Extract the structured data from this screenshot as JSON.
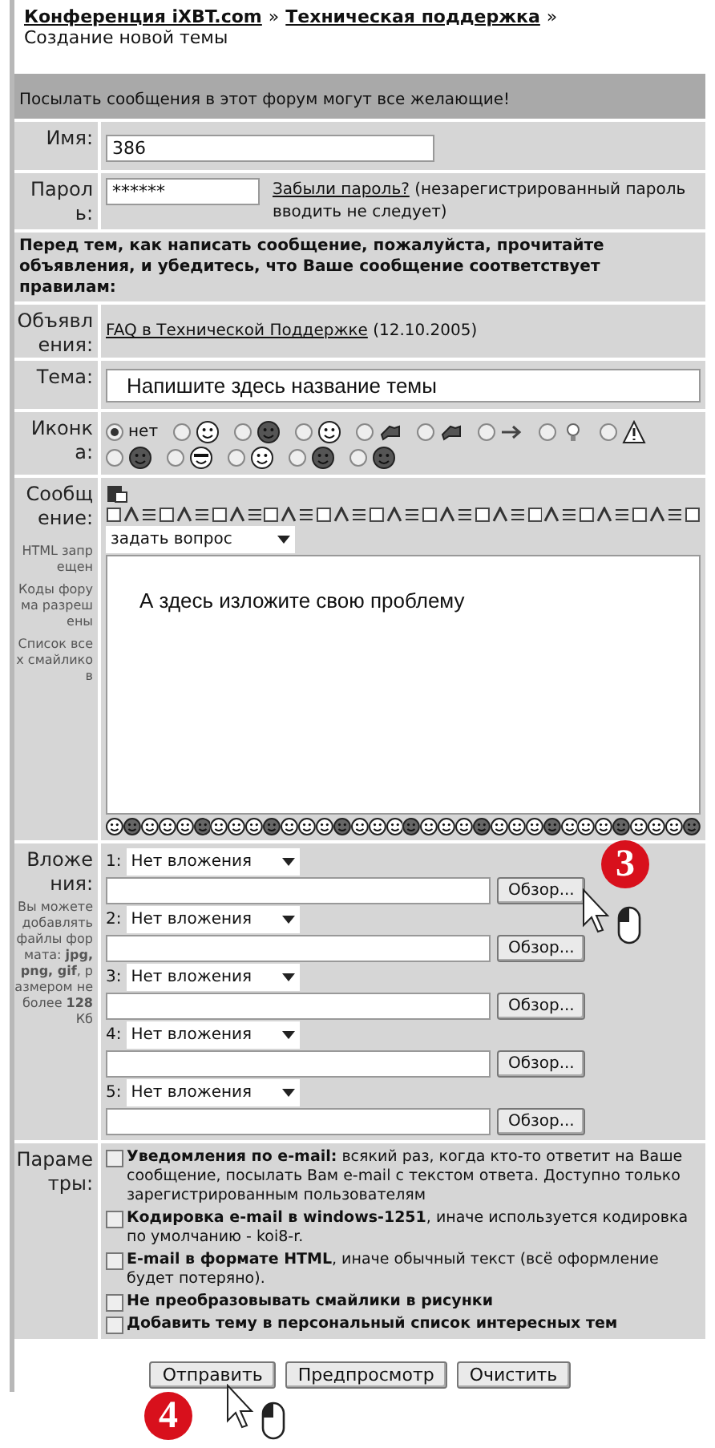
{
  "breadcrumb": {
    "links": [
      "Конференция iXBT.com",
      "Техническая поддержка"
    ],
    "separator": "»",
    "current": "Создание новой темы"
  },
  "notice_bar": "Посылать сообщения в этот форум могут все желающие!",
  "name_field": {
    "label": "Имя:",
    "value": "386"
  },
  "password_field": {
    "label": "Пароль:",
    "value": "******",
    "forgot_link": "Забыли пароль?",
    "hint": "(незарегистрированный пароль вводить не следует)"
  },
  "rules_notice": "Перед тем, как написать сообщение, пожалуйста, прочитайте объявления, и убедитесь, что Ваше сообщение соответствует правилам:",
  "announcements": {
    "label": "Объявления:",
    "link": "FAQ в Технической Поддержке",
    "date": "(12.10.2005)"
  },
  "subject": {
    "label": "Тема:",
    "value": "Напишите здесь название темы"
  },
  "icon_field": {
    "label": "Иконка:",
    "options": [
      {
        "label": "нет",
        "selected": true
      },
      {
        "selected": false
      },
      {
        "selected": false
      },
      {
        "selected": false
      },
      {
        "selected": false
      },
      {
        "selected": false
      },
      {
        "selected": false
      },
      {
        "selected": false
      },
      {
        "selected": false
      },
      {
        "selected": false
      },
      {
        "selected": false
      },
      {
        "selected": false
      },
      {
        "selected": false
      },
      {
        "selected": false
      }
    ]
  },
  "message": {
    "label": "Сообщение:",
    "notes": [
      "HTML запрещен",
      "Коды форума разрешены",
      "Список всех смайликов"
    ],
    "select_value": "задать вопрос",
    "value": "А здесь изложите свою проблему"
  },
  "attachments": {
    "label": "Вложения:",
    "hint": "Вы можете добавлять файлы формата: **jpg, png, gif**, размером не более **128** Кб",
    "items": [
      {
        "number": "1:",
        "select_value": "Нет вложения",
        "browse": "Обзор..."
      },
      {
        "number": "2:",
        "select_value": "Нет вложения",
        "browse": "Обзор..."
      },
      {
        "number": "3:",
        "select_value": "Нет вложения",
        "browse": "Обзор..."
      },
      {
        "number": "4:",
        "select_value": "Нет вложения",
        "browse": "Обзор..."
      },
      {
        "number": "5:",
        "select_value": "Нет вложения",
        "browse": "Обзор..."
      }
    ]
  },
  "options": {
    "label": "Параметры:",
    "items": [
      {
        "text": "**Уведомления по e-mail:** всякий раз, когда кто-то ответит на Ваше сообщение, посылать Вам e-mail с текстом ответа. Доступно только зарегистрированным пользователям",
        "checked": false
      },
      {
        "text": "**Кодировка e-mail в windows-1251**, иначе используется кодировка по умолчанию - koi8-r.",
        "checked": false
      },
      {
        "text": "**E-mail в формате HTML**, иначе обычный текст (всё оформление будет потеряно).",
        "checked": false
      },
      {
        "text": "**Не преобразовывать смайлики в рисунки**",
        "checked": false
      },
      {
        "text": "**Добавить тему в персональный список интересных тем**",
        "checked": false
      }
    ]
  },
  "buttons": [
    "Отправить",
    "Предпросмотр",
    "Очистить"
  ],
  "callouts": [
    {
      "number": "3"
    },
    {
      "number": "4"
    }
  ]
}
